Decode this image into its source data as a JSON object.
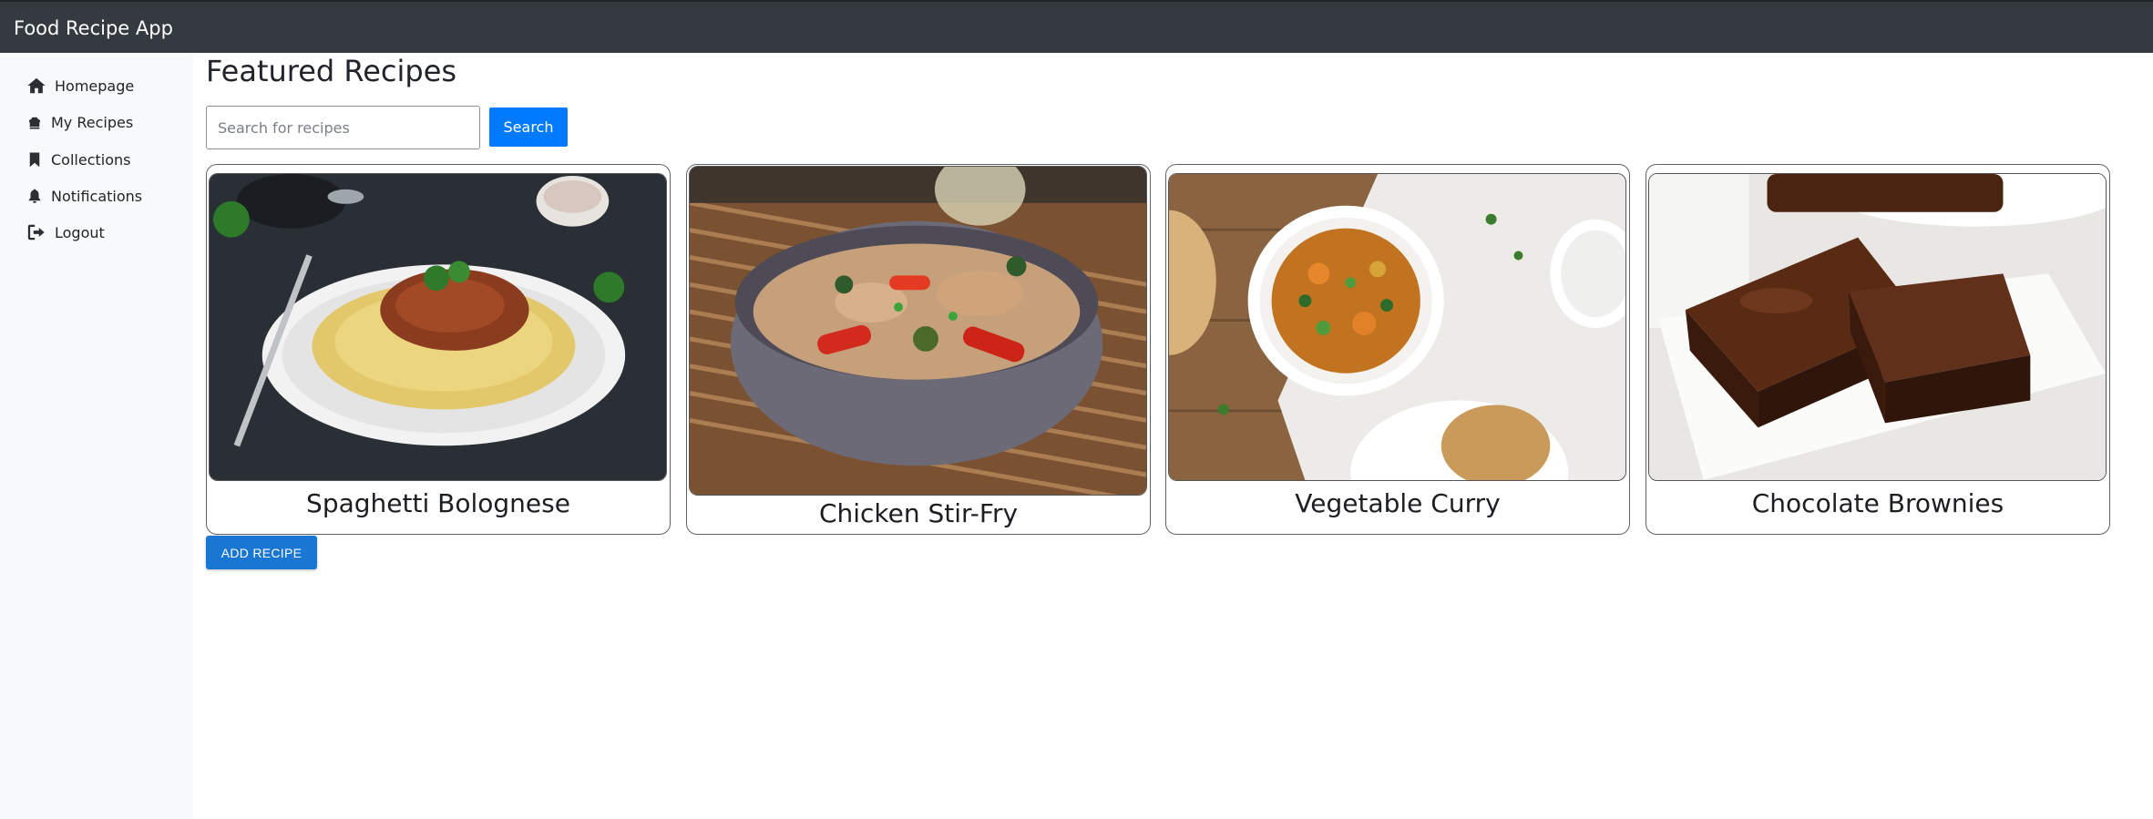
{
  "app": {
    "title": "Food Recipe App"
  },
  "sidebar": {
    "items": [
      {
        "label": "Homepage",
        "icon": "home-icon"
      },
      {
        "label": "My Recipes",
        "icon": "chef-hat-icon"
      },
      {
        "label": "Collections",
        "icon": "bookmark-icon"
      },
      {
        "label": "Notifications",
        "icon": "bell-icon"
      },
      {
        "label": "Logout",
        "icon": "logout-icon"
      }
    ]
  },
  "main": {
    "title": "Featured Recipes",
    "search": {
      "placeholder": "Search for recipes",
      "value": "",
      "button_label": "Search"
    },
    "recipes": [
      {
        "title": "Spaghetti Bolognese"
      },
      {
        "title": "Chicken Stir-Fry"
      },
      {
        "title": "Vegetable Curry"
      },
      {
        "title": "Chocolate Brownies"
      }
    ],
    "add_button_label": "ADD RECIPE"
  },
  "colors": {
    "navbar": "#343a40",
    "sidebar": "#f8f9fa",
    "search_button": "#007bff",
    "add_button": "#1976d2"
  }
}
